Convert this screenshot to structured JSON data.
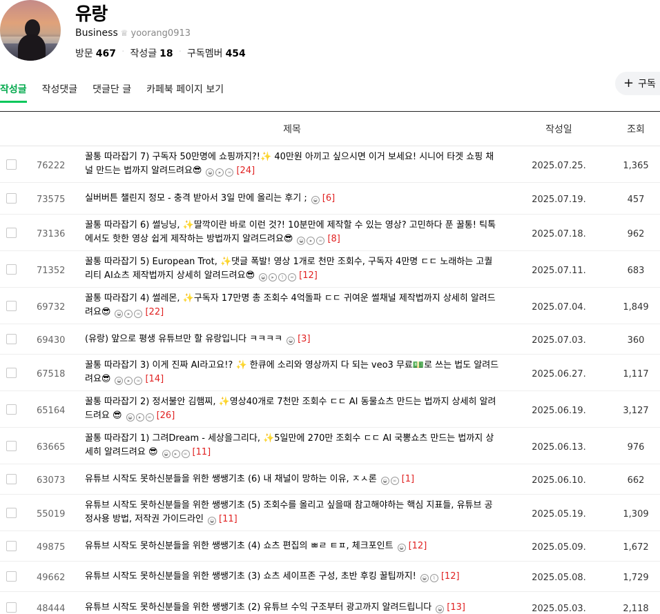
{
  "profile": {
    "name": "유랑",
    "grade": "Business",
    "user_id": "yoorang0913",
    "stats": [
      {
        "label": "방문",
        "value": "467"
      },
      {
        "label": "작성글",
        "value": "18"
      },
      {
        "label": "구독멤버",
        "value": "454"
      }
    ]
  },
  "tabs": [
    {
      "label": "작성글",
      "active": true
    },
    {
      "label": "작성댓글",
      "active": false
    },
    {
      "label": "댓글단 글",
      "active": false
    },
    {
      "label": "카페북 페이지 보기",
      "active": false
    }
  ],
  "subscribe_label": "구독",
  "table": {
    "headers": {
      "title": "제목",
      "date": "작성일",
      "views": "조회"
    },
    "rows": [
      {
        "no": "76222",
        "title": "꿀통 따라잡기 7) 구독자 50만명에 쇼핑까지?!✨ 40만원 아끼고 싶으시면 이거 보세요! 시니어 타겟 쇼핑 채널 만드는 법까지 알려드려요😎",
        "icons": [
          "img",
          "video",
          "link"
        ],
        "comments": "[24]",
        "date": "2025.07.25.",
        "views": "1,365"
      },
      {
        "no": "73575",
        "title": "실버버튼 챌린지 정모 - 충격 받아서 3일 만에 올리는 후기 ;",
        "icons": [
          "img"
        ],
        "comments": "[6]",
        "date": "2025.07.19.",
        "views": "457"
      },
      {
        "no": "73136",
        "title": "꿀통 따라잡기 6) 썰닝닝, ✨딸깍이란 바로 이런 것?! 10분만에 제작할 수 있는 영상? 고민하다 푼 꿀통! 틱톡에서도 핫한 영상 쉽게 제작하는 방법까지 알려드려요😎",
        "icons": [
          "img",
          "video",
          "link"
        ],
        "comments": "[8]",
        "date": "2025.07.18.",
        "views": "962"
      },
      {
        "no": "71352",
        "title": "꿀통 따라잡기 5) European Trot, ✨댓글 폭발! 영상 1개로 천만 조회수, 구독자 4만명 ㄷㄷ 노래하는 고퀄리티 AI쇼츠 제작법까지 상세히 알려드려요😎",
        "icons": [
          "img",
          "video",
          "file",
          "link"
        ],
        "comments": "[12]",
        "date": "2025.07.11.",
        "views": "683"
      },
      {
        "no": "69732",
        "title": "꿀통 따라잡기 4) 썰레몬, ✨구독자 17만명 총 조회수 4억돌파 ㄷㄷ 귀여운 썰채널 제작법까지 상세히 알려드려요😎",
        "icons": [
          "img",
          "video",
          "link"
        ],
        "comments": "[22]",
        "date": "2025.07.04.",
        "views": "1,849"
      },
      {
        "no": "69430",
        "title": "(유랑) 앞으로 평생 유튜브만 할 유랑입니다 ㅋㅋㅋㅋ",
        "icons": [
          "img"
        ],
        "comments": "[3]",
        "date": "2025.07.03.",
        "views": "360"
      },
      {
        "no": "67518",
        "title": "꿀통 따라잡기 3) 이게 진짜 AI라고요!? ✨ 한큐에 소리와 영상까지 다 되는 veo3 무료💵로 쓰는 법도 알려드려요😎",
        "icons": [
          "img",
          "video",
          "link"
        ],
        "comments": "[14]",
        "date": "2025.06.27.",
        "views": "1,117"
      },
      {
        "no": "65164",
        "title": "꿀통 따라잡기 2) 정서불안 김햄찌, ✨영상40개로 7천만 조회수 ㄷㄷ AI 동물쇼츠 만드는 법까지 상세히 알려드려요 😎",
        "icons": [
          "img",
          "video",
          "link"
        ],
        "comments": "[26]",
        "date": "2025.06.19.",
        "views": "3,127"
      },
      {
        "no": "63665",
        "title": "꿀통 따라잡기 1) 그려Dream - 세상을그리다, ✨5일만에 270만 조회수 ㄷㄷ AI 국뽕쇼츠 만드는 법까지 상세히 알려드려요 😎",
        "icons": [
          "img",
          "video",
          "link"
        ],
        "comments": "[11]",
        "date": "2025.06.13.",
        "views": "976"
      },
      {
        "no": "63073",
        "title": "유튜브 시작도 못하신분들을 위한 쌩쌩기초 (6) 내 채널이 망하는 이유, ㅈㅅ론",
        "icons": [
          "img",
          "link"
        ],
        "comments": "[1]",
        "date": "2025.06.10.",
        "views": "662"
      },
      {
        "no": "55019",
        "title": "유튜브 시작도 못하신분들을 위한 쌩쌩기초 (5) 조회수를 올리고 싶을때 참고해야하는 핵심 지표들, 유튜브 공정사용 방법, 저작권 가이드라인",
        "icons": [
          "img"
        ],
        "comments": "[11]",
        "date": "2025.05.19.",
        "views": "1,309"
      },
      {
        "no": "49875",
        "title": "유튜브 시작도 못하신분들을 위한 쌩쌩기초 (4) 쇼츠 편집의 ㅃㄹ ㅌㅍ, 체크포인트",
        "icons": [
          "img"
        ],
        "comments": "[12]",
        "date": "2025.05.09.",
        "views": "1,672"
      },
      {
        "no": "49662",
        "title": "유튜브 시작도 못하신분들을 위한 쌩쌩기초 (3) 쇼츠 세이프존 구성, 초반 후킹 꿀팁까지!",
        "icons": [
          "img",
          "file"
        ],
        "comments": "[12]",
        "date": "2025.05.08.",
        "views": "1,729"
      },
      {
        "no": "48444",
        "title": "유튜브 시작도 못하신분들을 위한 쌩쌩기초 (2) 유튜브 수익 구조부터 광고까지 알려드립니다",
        "icons": [
          "img"
        ],
        "comments": "[13]",
        "date": "2025.05.03.",
        "views": "2,118"
      }
    ]
  },
  "colors": {
    "accent": "#03c75a",
    "comment": "#e02020"
  }
}
